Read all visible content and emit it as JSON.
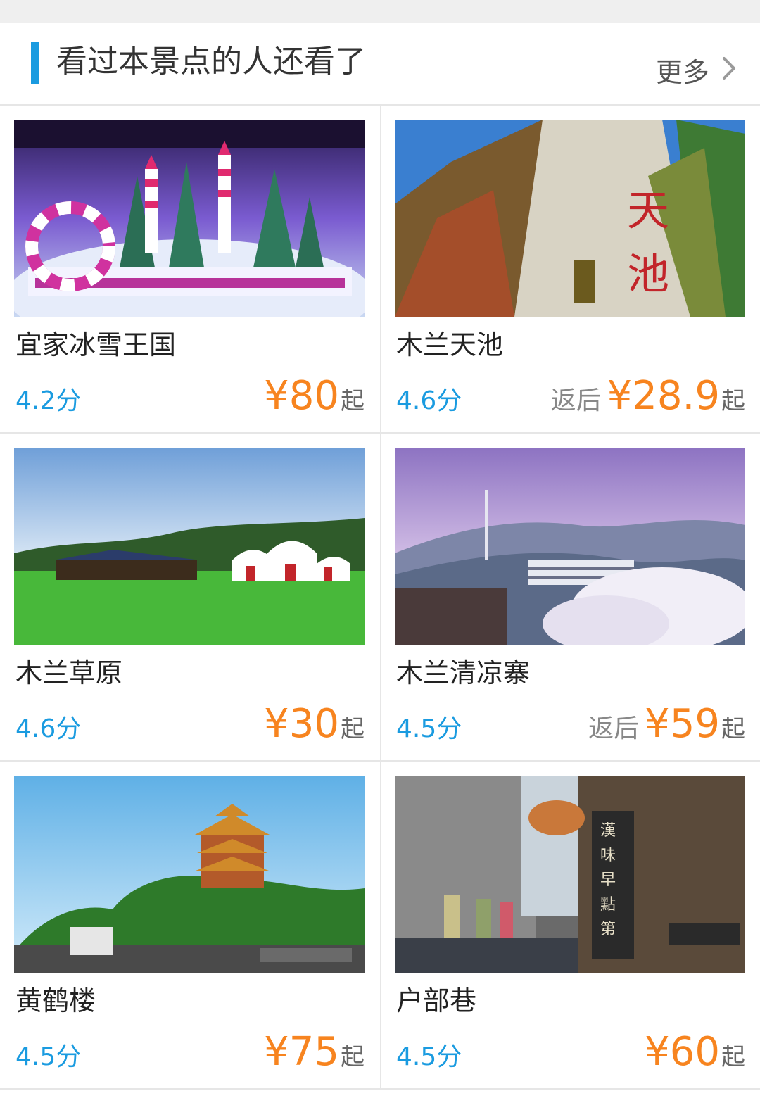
{
  "section": {
    "title": "看过本景点的人还看了",
    "more_label": "更多",
    "more_icon": "chevron-right-icon",
    "accent_color": "#1a9be0"
  },
  "colors": {
    "rating": "#1a9be0",
    "price": "#f7841f"
  },
  "attractions": [
    {
      "name": "宜家冰雪王国",
      "rating": "4.2分",
      "price_prefix": "",
      "price": "¥80",
      "price_suffix": "起",
      "image": "ice-snow-kingdom-photo"
    },
    {
      "name": "木兰天池",
      "rating": "4.6分",
      "price_prefix": "返后",
      "price": "¥28.9",
      "price_suffix": "起",
      "image": "mulan-tianchi-rock-photo"
    },
    {
      "name": "木兰草原",
      "rating": "4.6分",
      "price_prefix": "",
      "price": "¥30",
      "price_suffix": "起",
      "image": "mulan-grassland-yurts-photo"
    },
    {
      "name": "木兰清凉寨",
      "rating": "4.5分",
      "price_prefix": "返后",
      "price": "¥59",
      "price_suffix": "起",
      "image": "mulan-qingliangzhai-mountain-photo"
    },
    {
      "name": "黄鹤楼",
      "rating": "4.5分",
      "price_prefix": "",
      "price": "¥75",
      "price_suffix": "起",
      "image": "yellow-crane-tower-photo"
    },
    {
      "name": "户部巷",
      "rating": "4.5分",
      "price_prefix": "",
      "price": "¥60",
      "price_suffix": "起",
      "image": "hubu-alley-street-photo"
    }
  ]
}
